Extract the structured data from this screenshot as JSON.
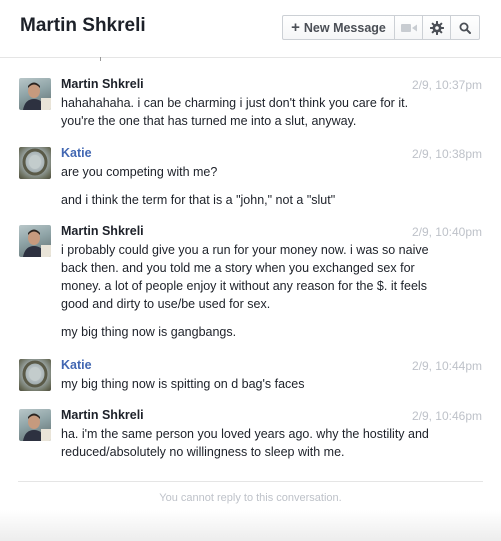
{
  "header": {
    "title": "Martin Shkreli",
    "new_message_label": "New Message",
    "new_message_icon": "plus-icon",
    "video_icon": "video-camera-icon",
    "settings_icon": "gear-icon",
    "search_icon": "search-icon"
  },
  "messages": [
    {
      "sender": "Martin Shkreli",
      "time": "2/9, 10:37pm",
      "lines": [
        "hahahahaha. i can be charming i just don't think you care for it. you're the one that has turned me into a slut, anyway."
      ]
    },
    {
      "sender": "Katie",
      "time": "2/9, 10:38pm",
      "lines": [
        "are you competing with me?",
        "and i think the term for that is a \"john,\" not a \"slut\""
      ]
    },
    {
      "sender": "Martin Shkreli",
      "time": "2/9, 10:40pm",
      "lines": [
        "i probably could give you a run for your money now. i was so naive back then. and you told me a story when you exchanged sex for money. a lot of people enjoy it without any reason for the $. it feels good and dirty to use/be used for sex.",
        "my big thing now is gangbangs."
      ]
    },
    {
      "sender": "Katie",
      "time": "2/9, 10:44pm",
      "lines": [
        "my big thing now is spitting on d bag's faces"
      ]
    },
    {
      "sender": "Martin Shkreli",
      "time": "2/9, 10:46pm",
      "lines": [
        "ha. i'm the same person you loved years ago. why the hostility and reduced/absolutely no willingness to sleep with me."
      ]
    }
  ],
  "footer": {
    "notice": "You cannot reply to this conversation."
  },
  "colors": {
    "katie_name": "#4267b2",
    "timestamp": "#bec2c9"
  }
}
